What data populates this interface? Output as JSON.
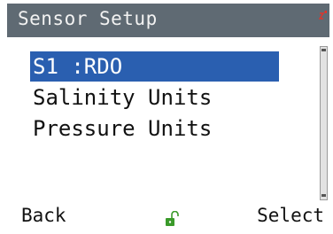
{
  "header": {
    "title": "Sensor Setup",
    "status_icon": "battery-status-icon"
  },
  "menu": {
    "items": [
      {
        "label": "S1 :RDO",
        "selected": true
      },
      {
        "label": "Salinity Units",
        "selected": false
      },
      {
        "label": "Pressure Units",
        "selected": false
      }
    ]
  },
  "softkeys": {
    "left_label": "Back",
    "right_label": "Select",
    "center_icon": "unlocked-padlock-icon"
  },
  "colors": {
    "titlebar": "#5f6a73",
    "selection": "#2a5fb0",
    "lock_icon": "#3a9a2a"
  }
}
